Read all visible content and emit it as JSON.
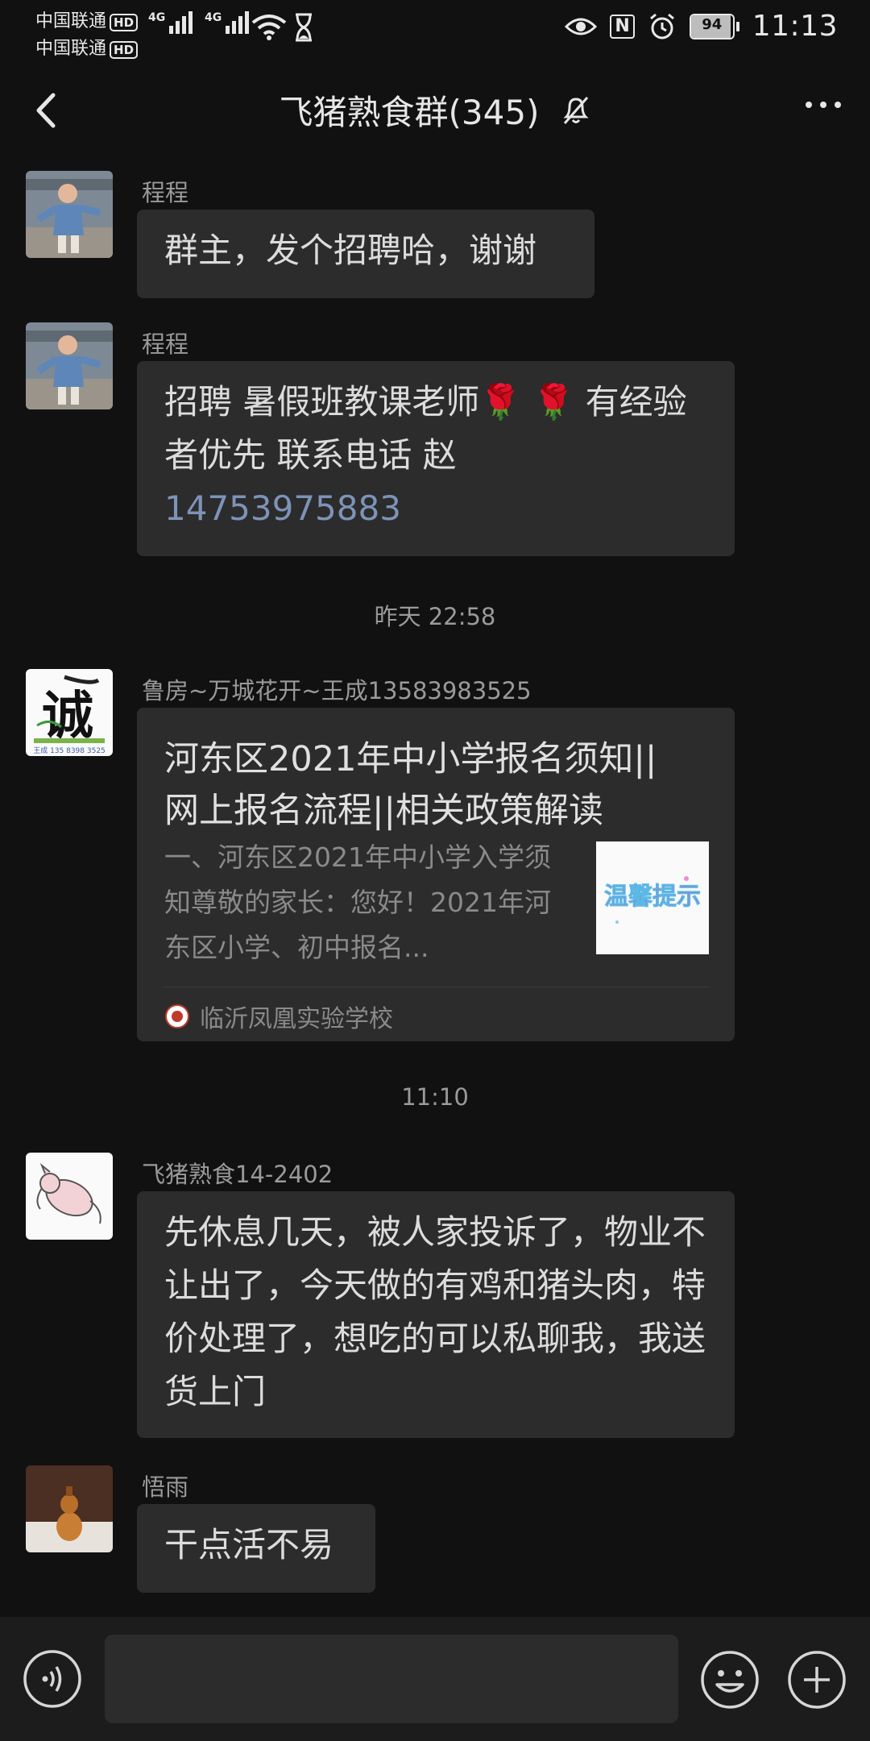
{
  "status_bar": {
    "carrier1": "中国联通",
    "carrier2": "中国联通",
    "hd_label": "HD",
    "network1": "4G",
    "network2": "4G",
    "nfc": "N",
    "battery_level": 94,
    "time": "11:13"
  },
  "header": {
    "title": "飞猪熟食群(345)"
  },
  "messages": [
    {
      "sender": "程程",
      "text": "群主，发个招聘哈，谢谢"
    },
    {
      "sender": "程程",
      "line1": "招聘 暑假班教课老师🌹 🌹 有经验",
      "line2": "者优先   联系电话 赵",
      "phone": "14753975883"
    },
    {
      "sender": "鲁房~万城花开~王成13583983525",
      "card_title_line1": "河东区2021年中小学报名须知||",
      "card_title_line2": "网上报名流程||相关政策解读",
      "card_desc": "一、河东区2021年中小学入学须知尊敬的家长：您好！2021年河东区小学、初中报名...",
      "card_thumb_text": "温馨提示",
      "card_source": "临沂凤凰实验学校"
    },
    {
      "sender": "飞猪熟食14-2402",
      "text": "先休息几天，被人家投诉了，物业不让出了，今天做的有鸡和猪头肉，特价处理了，想吃的可以私聊我，我送货上门"
    },
    {
      "sender": "悟雨",
      "text": "干点活不易"
    }
  ],
  "avatars": {
    "a3_char": "诚",
    "a3_phone": "王成 135 8398 3525"
  },
  "timestamps": {
    "t1": "昨天 22:58",
    "t2": "11:10"
  },
  "input_bar": {
    "voice_icon": "voice-icon",
    "emoji_icon": "emoji-icon",
    "plus_icon": "plus-icon"
  }
}
